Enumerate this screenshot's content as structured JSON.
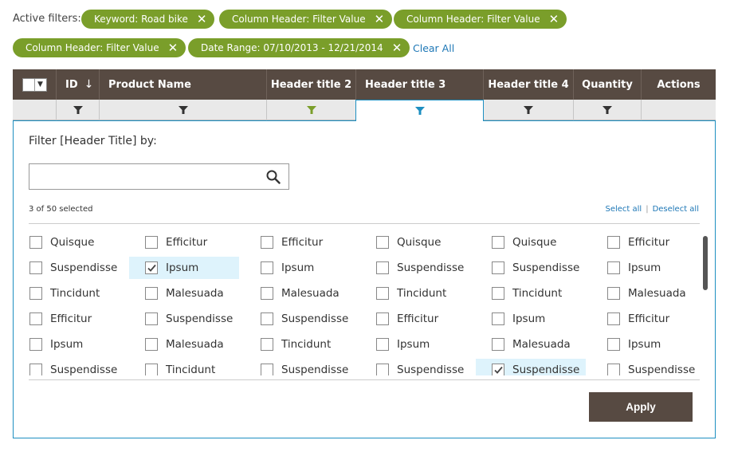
{
  "active_filters": {
    "label": "Active filters:",
    "chips": [
      {
        "text": "Keyword: Road bike"
      },
      {
        "text": "Column Header: Filter Value"
      },
      {
        "text": "Column Header: Filter Value"
      },
      {
        "text": "Column Header: Filter Value"
      },
      {
        "text": "Date Range: 07/10/2013 - 12/21/2014"
      }
    ],
    "clear_all": "Clear All",
    "remove_glyph": "✕"
  },
  "table": {
    "columns": [
      {
        "label": "",
        "type": "select"
      },
      {
        "label": "ID",
        "sort_icon": "↓"
      },
      {
        "label": "Product Name"
      },
      {
        "label": "Header title 2"
      },
      {
        "label": "Header title 3"
      },
      {
        "label": "Header title 4"
      },
      {
        "label": "Quantity"
      },
      {
        "label": "Actions"
      }
    ],
    "filter_icon_colors": {
      "default": "#333333",
      "applied": "#7a9e2a",
      "active": "#1d8fc1"
    }
  },
  "filter_panel": {
    "title": "Filter [Header Title] by:",
    "search": {
      "value": "",
      "placeholder": ""
    },
    "selected_count": "3 of 50 selected",
    "select_all": "Select all",
    "deselect_all": "Deselect all",
    "options": [
      [
        {
          "label": "Quisque",
          "checked": false
        },
        {
          "label": "Efficitur",
          "checked": false
        },
        {
          "label": "Efficitur",
          "checked": false
        },
        {
          "label": "Quisque",
          "checked": false
        },
        {
          "label": "Quisque",
          "checked": false
        },
        {
          "label": "Efficitur",
          "checked": false
        }
      ],
      [
        {
          "label": "Suspendisse",
          "checked": false
        },
        {
          "label": "Ipsum",
          "checked": true
        },
        {
          "label": "Ipsum",
          "checked": false
        },
        {
          "label": "Suspendisse",
          "checked": false
        },
        {
          "label": "Suspendisse",
          "checked": false
        },
        {
          "label": "Ipsum",
          "checked": false
        }
      ],
      [
        {
          "label": "Tincidunt",
          "checked": false
        },
        {
          "label": "Malesuada",
          "checked": false
        },
        {
          "label": "Malesuada",
          "checked": false
        },
        {
          "label": "Tincidunt",
          "checked": false
        },
        {
          "label": "Tincidunt",
          "checked": false
        },
        {
          "label": "Malesuada",
          "checked": false
        }
      ],
      [
        {
          "label": "Efficitur",
          "checked": false
        },
        {
          "label": "Suspendisse",
          "checked": false
        },
        {
          "label": "Suspendisse",
          "checked": false
        },
        {
          "label": "Efficitur",
          "checked": false
        },
        {
          "label": "Ipsum",
          "checked": false
        },
        {
          "label": "Efficitur",
          "checked": false
        }
      ],
      [
        {
          "label": "Ipsum",
          "checked": false
        },
        {
          "label": "Malesuada",
          "checked": false
        },
        {
          "label": "Tincidunt",
          "checked": false
        },
        {
          "label": "Ipsum",
          "checked": false
        },
        {
          "label": "Malesuada",
          "checked": false
        },
        {
          "label": "Ipsum",
          "checked": false
        }
      ],
      [
        {
          "label": "Suspendisse",
          "checked": false
        },
        {
          "label": "Tincidunt",
          "checked": false
        },
        {
          "label": "Suspendisse",
          "checked": false
        },
        {
          "label": "Suspendisse",
          "checked": false
        },
        {
          "label": "Suspendisse",
          "checked": true
        },
        {
          "label": "Suspendisse",
          "checked": false
        }
      ]
    ],
    "apply_label": "Apply"
  },
  "colors": {
    "chip": "#7a9e2a",
    "header": "#574a42",
    "accent": "#1d8fc1",
    "selected_bg": "#def3fc",
    "link": "#1d77b6"
  }
}
